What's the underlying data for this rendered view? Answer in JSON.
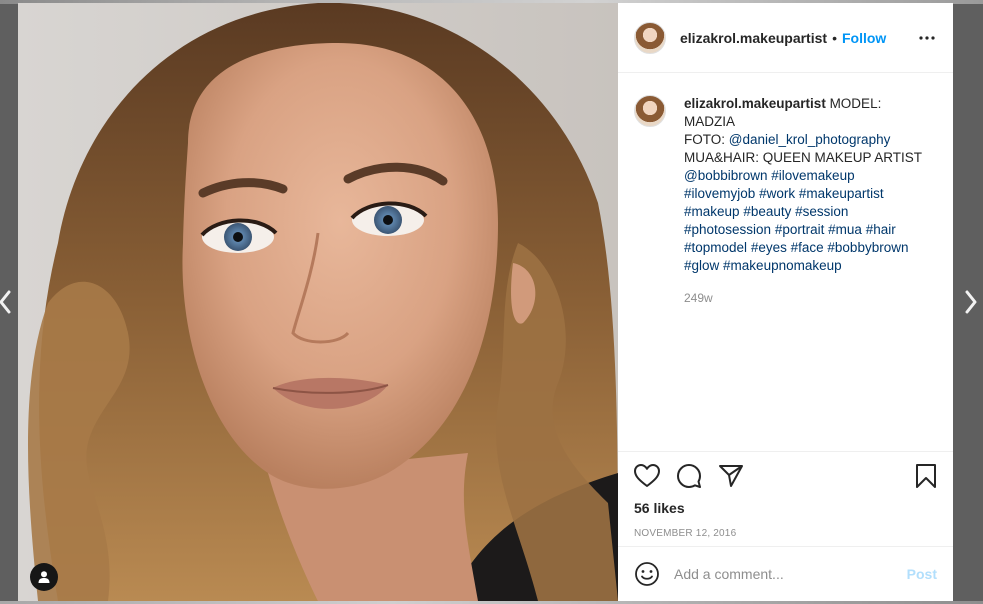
{
  "header": {
    "username": "elizakrol.makeupartist",
    "separator": "•",
    "follow_label": "Follow",
    "more_icon": "more-horizontal-icon"
  },
  "caption": {
    "username": "elizakrol.makeupartist",
    "text_intro": " MODEL: MADZIA",
    "foto_label": "FOTO: ",
    "foto_link": "@daniel_krol_photography",
    "mua_line": "MUA&HAIR: QUEEN MAKEUP ARTIST",
    "mentions": [
      "@bobbibrown",
      "#ilovemakeup"
    ],
    "hashtags": [
      "#ilovemyjob",
      "#work",
      "#makeupartist",
      "#makeup",
      "#beauty",
      "#session",
      "#photosession",
      "#portrait",
      "#mua",
      "#hair",
      "#topmodel",
      "#eyes",
      "#face",
      "#bobbybrown",
      "#glow",
      "#makeupnomakeup"
    ],
    "age": "249w"
  },
  "actions": {
    "like_icon": "heart-icon",
    "comment_icon": "comment-icon",
    "share_icon": "share-icon",
    "save_icon": "bookmark-icon",
    "likes": "56 likes",
    "date": "NOVEMBER 12, 2016"
  },
  "comment": {
    "emoji_icon": "emoji-icon",
    "placeholder": "Add a comment...",
    "post_label": "Post"
  },
  "colors": {
    "accent": "#0095f6",
    "link": "#00376b",
    "post_disabled": "#b2dffc",
    "muted": "#8e8e8e"
  }
}
